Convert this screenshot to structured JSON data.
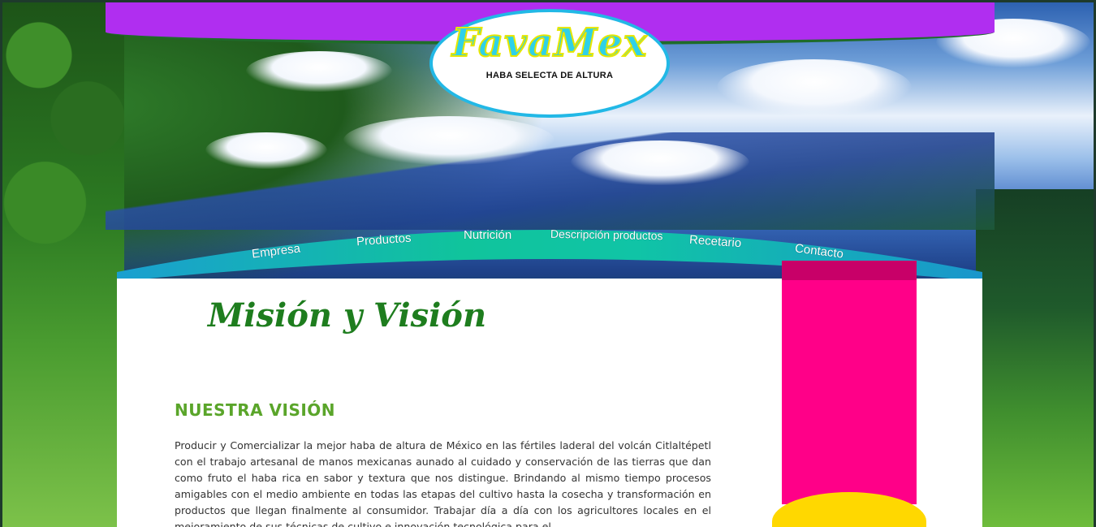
{
  "brand": {
    "name": "FavaMex",
    "tagline": "HABA SELECTA DE ALTURA"
  },
  "nav": {
    "items": [
      {
        "label": "Empresa"
      },
      {
        "label": "Productos"
      },
      {
        "label": "Nutrición"
      },
      {
        "label": "Descripción productos"
      },
      {
        "label": "Recetario"
      },
      {
        "label": "Contacto"
      }
    ]
  },
  "page": {
    "title": "Misión y Visión"
  },
  "section": {
    "heading": "NUESTRA VISIÓN",
    "body": "Producir y Comercializar la mejor haba de altura de México en las fértiles laderal del volcán Citlaltépetl con el trabajo artesanal de manos mexicanas aunado al cuidado y conservación de las tierras que dan como fruto el haba rica en sabor y textura que nos distingue. Brindando al mismo tiempo procesos amigables con el medio ambiente en todas las etapas del cultivo hasta la cosecha y transformación en productos que llegan finalmente al consumidor. Trabajar día a día con los agricultores locales en el mejoramiento de sus técnicas de cultivo e innovación tecnológica para el"
  },
  "colors": {
    "top_band": "#b02ef0",
    "logo_border": "#22b8e6",
    "nav_gradient_start": "#1aa0c8",
    "nav_gradient_mid": "#11c49a",
    "title_green": "#1e7d1e",
    "heading_green": "#5aa52a",
    "side_pink": "#ff0088",
    "side_yellow": "#ffd800"
  }
}
